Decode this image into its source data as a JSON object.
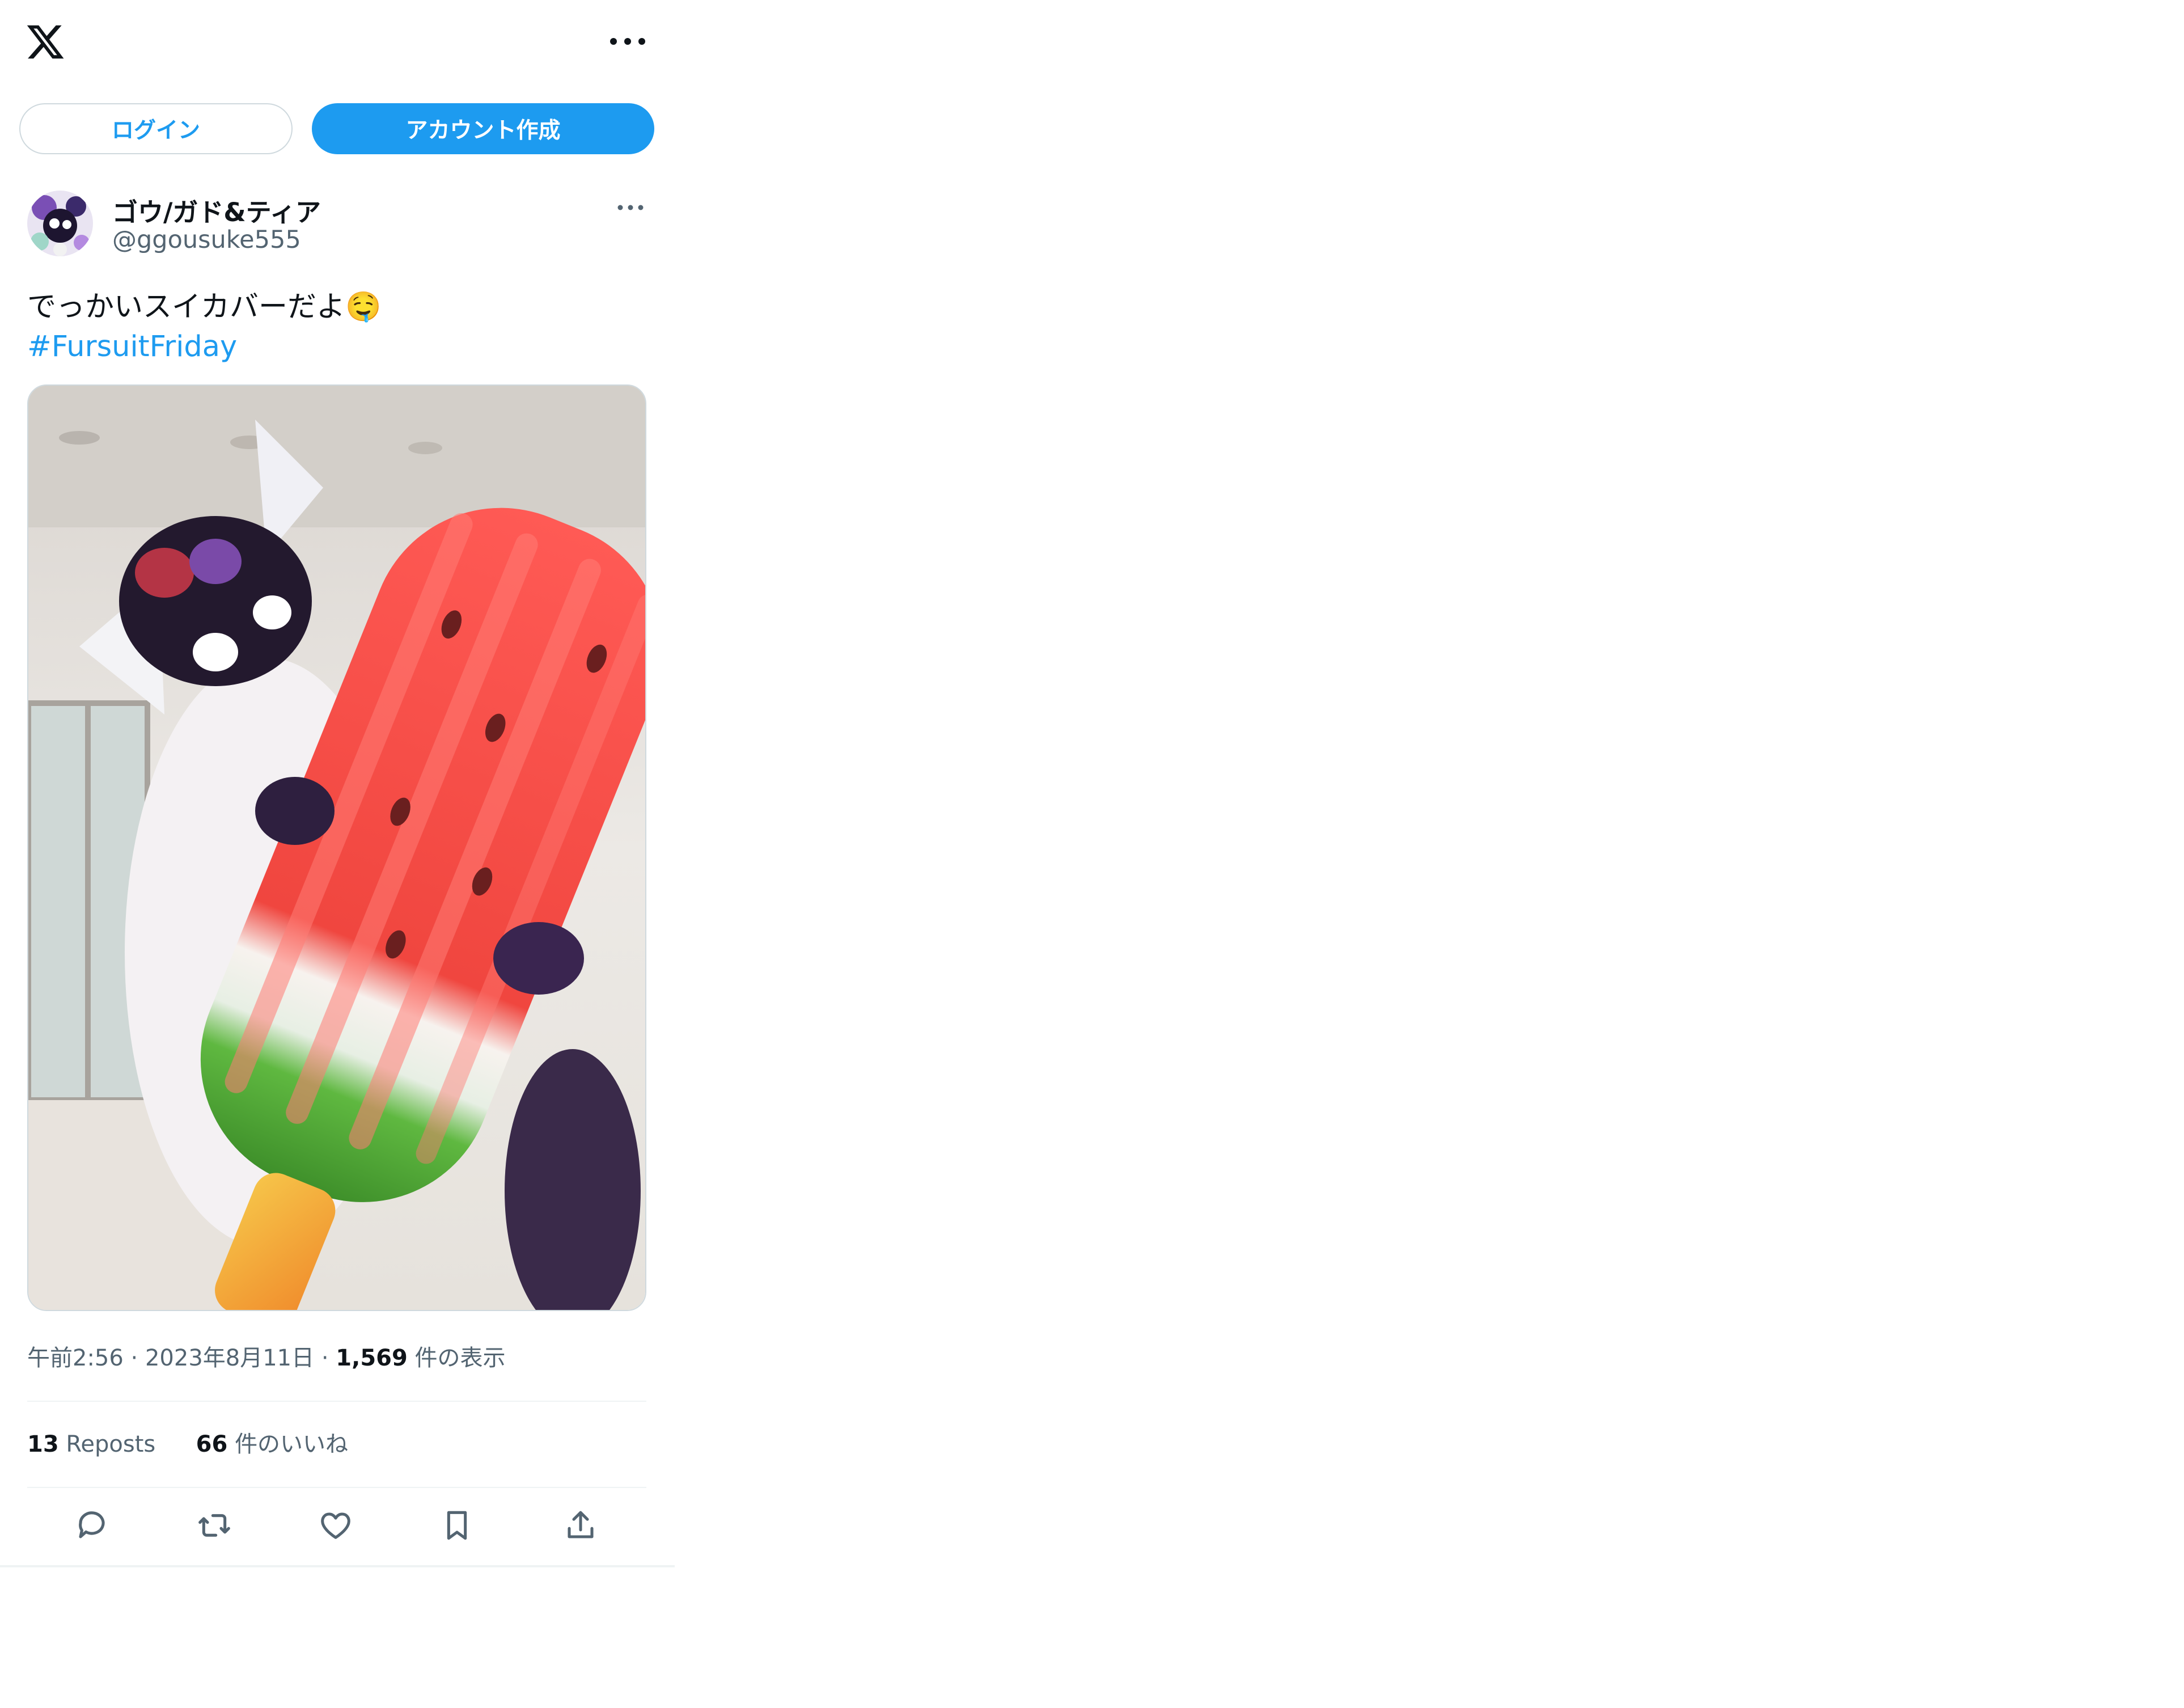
{
  "header": {
    "logo": "x-logo-icon",
    "menu_icon": "more-horizontal-icon"
  },
  "auth": {
    "login_label": "ログイン",
    "signup_label": "アカウント作成"
  },
  "tweet": {
    "author": {
      "display_name": "ゴウ/ガド&ティア",
      "handle": "@ggousuke555"
    },
    "text": "でっかいスイカバーだよ🤤",
    "hashtag": "#FursuitFriday",
    "time": "午前2:56",
    "date": "2023年8月11日",
    "views_count": "1,569",
    "views_label": "件の表示",
    "reposts_count": "13",
    "reposts_label": "Reposts",
    "likes_count": "66",
    "likes_label": "件のいいね",
    "actions": [
      "reply-icon",
      "repost-icon",
      "like-icon",
      "bookmark-icon",
      "share-icon"
    ]
  },
  "colors": {
    "accent": "#1d9bf0",
    "secondary_text": "#536471",
    "border": "#cfd9de"
  }
}
